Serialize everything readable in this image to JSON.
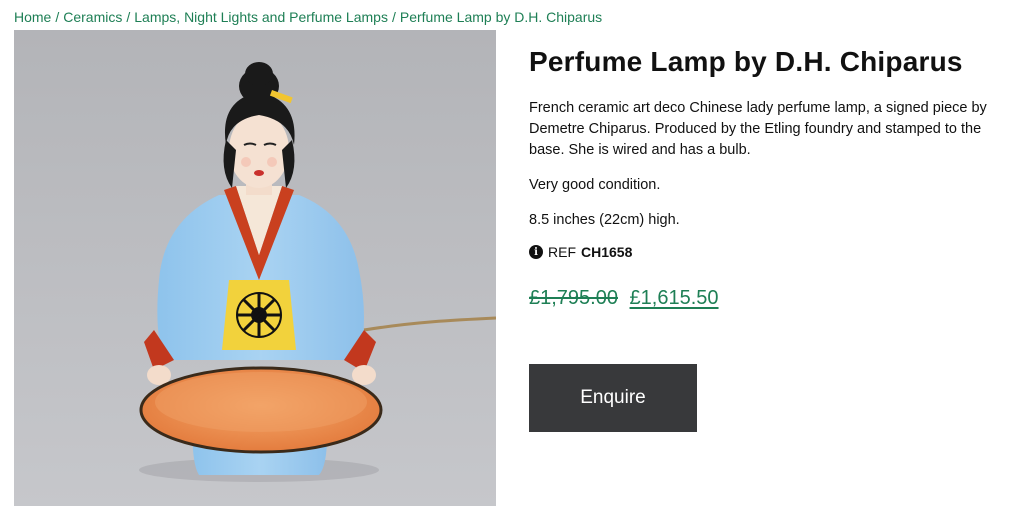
{
  "breadcrumb": {
    "items": [
      "Home",
      "Ceramics",
      "Lamps, Night Lights and Perfume Lamps",
      "Perfume Lamp by D.H. Chiparus"
    ],
    "separator": "/"
  },
  "product": {
    "title": "Perfume Lamp by D.H. Chiparus",
    "description": [
      "French ceramic art deco Chinese lady perfume lamp, a signed piece by Demetre Chiparus. Produced by the Etling foundry and stamped to the base. She is wired and has a bulb.",
      "Very good condition.",
      "8.5 inches (22cm) high."
    ],
    "ref_label": "REF",
    "ref_code": "CH1658",
    "info_icon_glyph": "i",
    "price_old": "£1,795.00",
    "price_new": "£1,615.50",
    "enquire_label": "Enquire"
  },
  "colors": {
    "link_green": "#1e7f55",
    "button_bg": "#38393b",
    "photo_bg": "#bcbdc1"
  },
  "icons": {
    "info": "info-icon"
  }
}
